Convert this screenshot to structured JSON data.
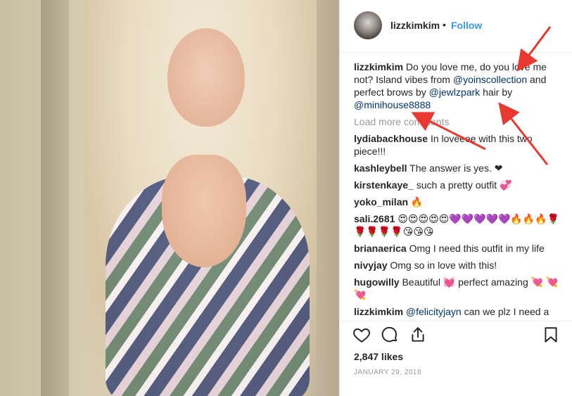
{
  "post": {
    "username": "lizzkimkim",
    "follow_label": "Follow",
    "dot": "•",
    "caption": {
      "username": "lizzkimkim",
      "text_1": "Do you love me, do you love me not? Island vibes from",
      "mention_1": "@yoinscollection",
      "text_2": "and perfect brows by",
      "mention_2": "@jewlzpark",
      "text_3": "hair by",
      "mention_3": "@minihouse8888"
    },
    "load_more": "Load more comments",
    "comments": [
      {
        "user": "lydiabackhouse",
        "text": "In loveeee with this two piece!!!"
      },
      {
        "user": "kashleybell",
        "text": "The answer is yes. ❤"
      },
      {
        "user": "kirstenkaye_",
        "text": "such a pretty outfit 💞"
      },
      {
        "user": "yoko_milan",
        "text": "🔥"
      },
      {
        "user": "sali.2681",
        "text": "😍😍😍😍😍💜💜💜💜💜🔥🔥🔥🌹🌹🌹🌹🌹😘😘😘"
      },
      {
        "user": "brianaerica",
        "text": "Omg I need this outfit in my life"
      },
      {
        "user": "nivyjay",
        "text": "Omg so in love with this!"
      },
      {
        "user": "hugowilly",
        "text": "Beautiful 💓 perfect amazing 💘 💘 💘"
      },
      {
        "user": "lizzkimkim",
        "mention": "@felicityjayn",
        "text": "can we plz I need a"
      }
    ],
    "likes": "2,847 likes",
    "date": "JANUARY 29, 2018",
    "icons": [
      "heart-icon",
      "comment-icon",
      "share-icon",
      "bookmark-icon"
    ]
  },
  "colors": {
    "link_blue": "#3897f0",
    "mention_blue": "#003569",
    "arrow_red": "#e8382f",
    "muted_gray": "#999999"
  }
}
